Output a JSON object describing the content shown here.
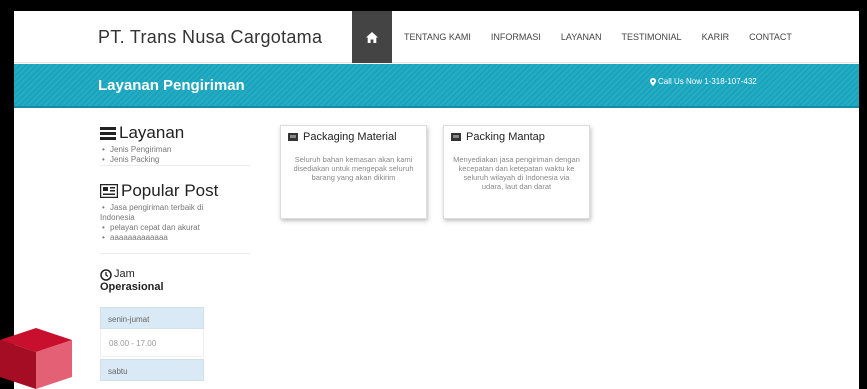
{
  "header": {
    "brand": "PT. Trans Nusa Cargotama",
    "nav": [
      "TENTANG KAMI",
      "INFORMASI",
      "LAYANAN",
      "TESTIMONIAL",
      "KARIR",
      "CONTACT"
    ],
    "home_icon": "home-icon"
  },
  "banner": {
    "title": "Layanan Pengiriman",
    "call": "Call Us Now 1-318-107-432",
    "call_icon": "map-marker-icon"
  },
  "sidebar": {
    "layanan": {
      "title": "Layanan",
      "icon": "list-icon",
      "items": [
        "Jenis Pengiriman",
        "Jenis Packing"
      ]
    },
    "popular": {
      "title": "Popular Post",
      "icon": "newspaper-icon",
      "items": [
        "Jasa pengiriman terbaik di",
        "Indonesia",
        "pelayan cepat dan akurat",
        "aaaaaaaaaaaaa"
      ]
    },
    "jam": {
      "title_line1": "Jam",
      "title_line2": "Operasional",
      "icon": "clock-icon",
      "rows": [
        {
          "day": "senin-jumat",
          "time": "08.00 - 17.00"
        },
        {
          "day": "sabtu",
          "time": ""
        }
      ]
    }
  },
  "cards": [
    {
      "title": "Packaging Material",
      "icon": "package-icon",
      "text": "Seluruh bahan kemasan akan kami disediakan untuk mengepak seluruh barang yang akan dikirim"
    },
    {
      "title": "Packing Mantap",
      "icon": "package-icon",
      "text": "Menyediakan jasa pengiriman dengan kecepatan dan ketepatan waktu ke seluruh wilayah di Indonesia via udara, laut dan darat"
    }
  ],
  "colors": {
    "banner": "#1aa3bb",
    "nav_active": "#444444",
    "schedule_header": "#d9e9f5",
    "logo": "#c8102e"
  }
}
